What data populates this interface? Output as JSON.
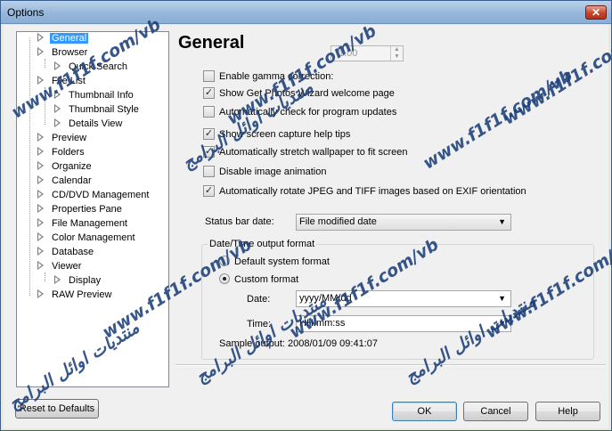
{
  "window": {
    "title": "Options",
    "close_label": "✕"
  },
  "tree": {
    "items": [
      {
        "label": "General",
        "selected": true
      },
      {
        "label": "Browser"
      },
      {
        "label": "Quick Search"
      },
      {
        "label": "File List"
      },
      {
        "label": "Thumbnail Info"
      },
      {
        "label": "Thumbnail Style"
      },
      {
        "label": "Details View"
      },
      {
        "label": "Preview"
      },
      {
        "label": "Folders"
      },
      {
        "label": "Organize"
      },
      {
        "label": "Calendar"
      },
      {
        "label": "CD/DVD Management"
      },
      {
        "label": "Properties Pane"
      },
      {
        "label": "File Management"
      },
      {
        "label": "Color Management"
      },
      {
        "label": "Database"
      },
      {
        "label": "Viewer"
      },
      {
        "label": "Display"
      },
      {
        "label": "RAW Preview"
      }
    ]
  },
  "general": {
    "heading": "General",
    "options": [
      {
        "label": "Enable gamma correction:",
        "checked": false
      },
      {
        "label": "Show Get Photos Wizard welcome page",
        "checked": true
      },
      {
        "label": "Automatically check for program updates",
        "checked": false
      },
      {
        "label": "Show screen capture help tips",
        "checked": true
      },
      {
        "label": "Automatically stretch wallpaper to fit screen",
        "checked": true
      },
      {
        "label": "Disable image animation",
        "checked": false
      },
      {
        "label": "Automatically rotate JPEG and TIFF images based on EXIF orientation",
        "checked": true
      }
    ],
    "gamma_value": "1.00",
    "status_bar_date_label": "Status bar date:",
    "status_bar_date_value": "File modified date",
    "datetime_group_label": "Date/Time output format",
    "radio_default": "Default system format",
    "radio_custom": "Custom format",
    "date_label": "Date:",
    "date_value": "yyyy/MM/dd",
    "time_label": "Time:",
    "time_value": "HH:mm:ss",
    "sample_output": "Sample output: 2008/01/09 09:41:07"
  },
  "buttons": {
    "reset": "Reset to Defaults",
    "ok": "OK",
    "cancel": "Cancel",
    "help": "Help"
  },
  "watermark": {
    "url": "www.f1f1f.com/vb",
    "arabic": "منتديات اوائل البرامج"
  }
}
